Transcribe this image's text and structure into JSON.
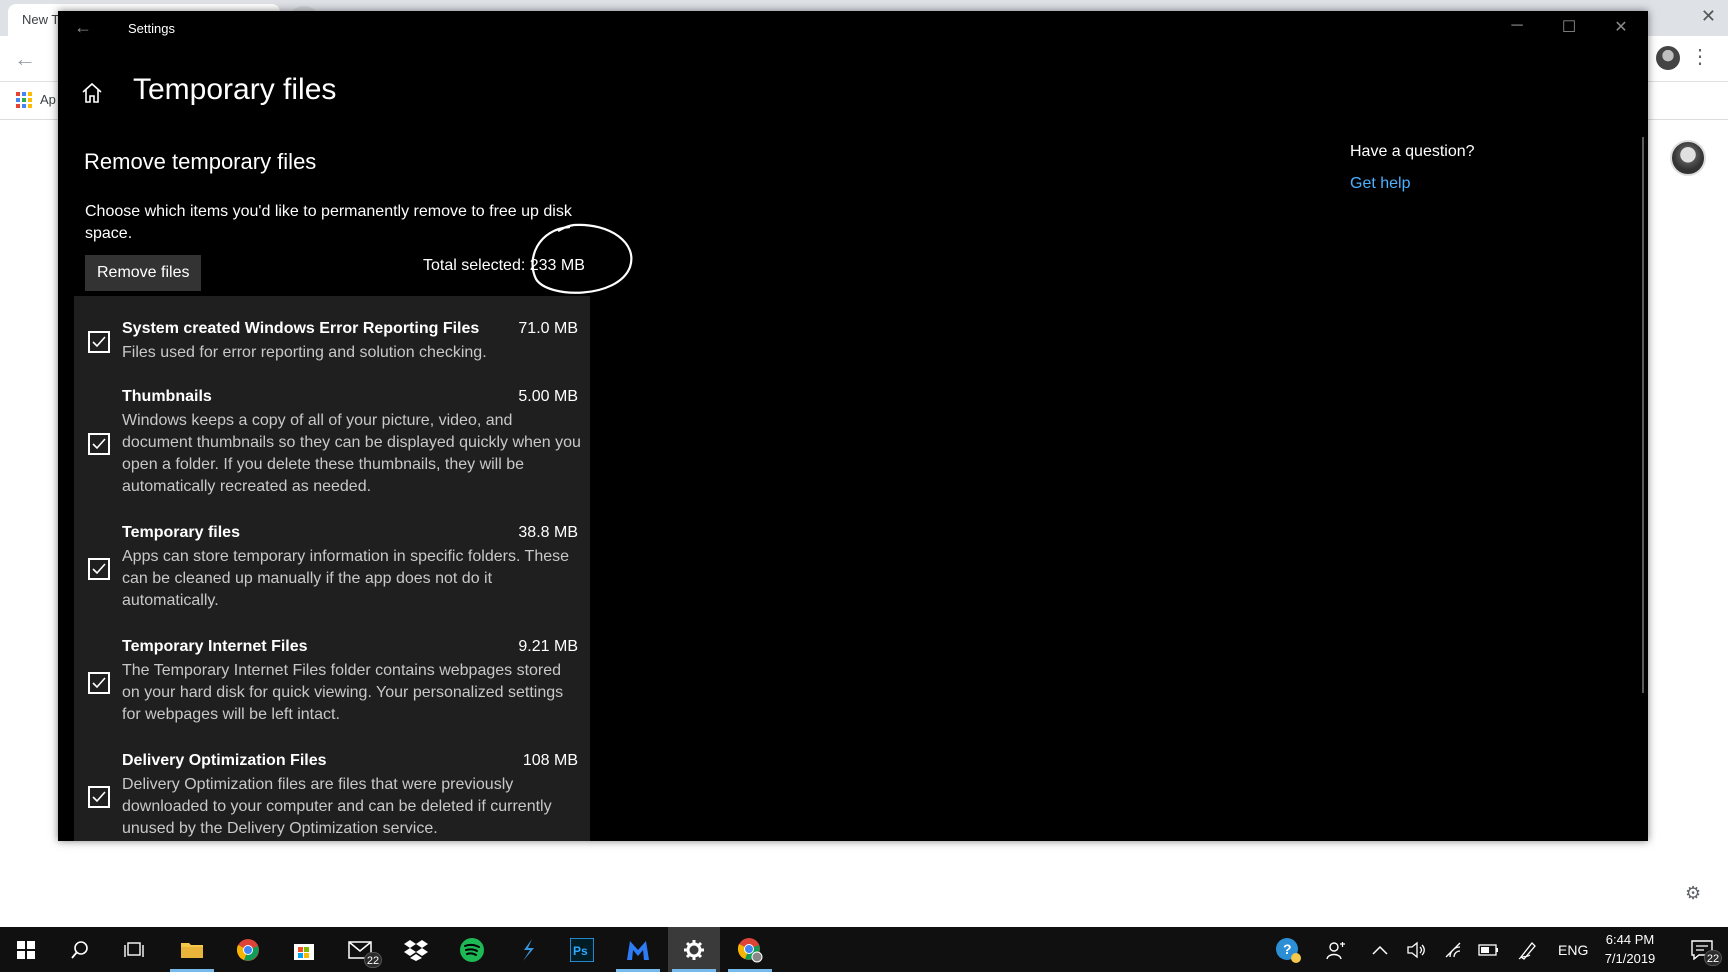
{
  "browser": {
    "tab_title": "New T",
    "bookmarks_label": "Ap"
  },
  "window": {
    "title": "Settings"
  },
  "page": {
    "title": "Temporary files",
    "section_heading": "Remove temporary files",
    "description": "Choose which items you'd like to permanently remove to free up disk space.",
    "remove_button": "Remove files",
    "total_selected": "Total selected: 233 MB"
  },
  "help": {
    "heading": "Have a question?",
    "link": "Get help"
  },
  "items": [
    {
      "name": "System created Windows Error Reporting Files",
      "size": "71.0 MB",
      "description": "Files used for error reporting and solution checking.",
      "checked": true
    },
    {
      "name": "Thumbnails",
      "size": "5.00 MB",
      "description": "Windows keeps a copy of all of your picture, video, and document thumbnails so they can be displayed quickly when you open a folder. If you delete these thumbnails, they will be automatically recreated as needed.",
      "checked": true
    },
    {
      "name": "Temporary files",
      "size": "38.8 MB",
      "description": "Apps can store temporary information in specific folders. These can be cleaned up manually if the app does not do it automatically.",
      "checked": true
    },
    {
      "name": "Temporary Internet Files",
      "size": "9.21 MB",
      "description": "The Temporary Internet Files folder contains webpages stored on your hard disk for quick viewing. Your personalized settings for webpages will be left intact.",
      "checked": true
    },
    {
      "name": "Delivery Optimization Files",
      "size": "108 MB",
      "description": "Delivery Optimization files are files that were previously downloaded to your computer and can be deleted if currently unused by the Delivery Optimization service.",
      "checked": true
    }
  ],
  "taskbar": {
    "mail_badge": "22",
    "language": "ENG",
    "time": "6:44 PM",
    "date": "7/1/2019",
    "notification_badge": "22"
  },
  "colors": {
    "accent": "#76b9ed",
    "link": "#4cb0ff",
    "window_bg": "#000000",
    "list_bg": "#1f1f1f"
  }
}
